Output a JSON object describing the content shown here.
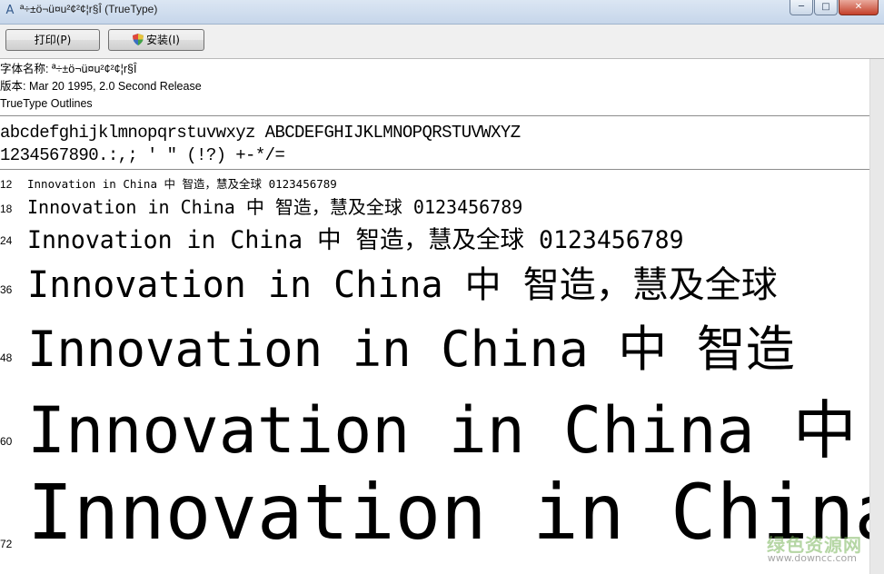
{
  "window": {
    "title": "ª÷±ö¬ü¤u²¢²¢¦r§Î (TrueType)",
    "controls": {
      "minimize": "─",
      "maximize": "□",
      "close": "✕"
    }
  },
  "toolbar": {
    "print_label": "打印(P)",
    "install_label": "安装(I)"
  },
  "font_info": {
    "name_line": "字体名称: ª÷±ö¬ü¤u²¢²¢¦r§Î",
    "version_line": "版本: Mar 20 1995, 2.0 Second Release",
    "type_line": "TrueType Outlines"
  },
  "charset": {
    "line1": "abcdefghijklmnopqrstuvwxyz ABCDEFGHIJKLMNOPQRSTUVWXYZ",
    "line2": "1234567890.:,; ' \" (!?) +-*/="
  },
  "samples": [
    {
      "size": "12",
      "text": "Innovation in China 中  智造，慧及全球 0123456789"
    },
    {
      "size": "18",
      "text": "Innovation in China 中  智造，慧及全球 0123456789"
    },
    {
      "size": "24",
      "text": "Innovation in China 中  智造，慧及全球 0123456789"
    },
    {
      "size": "36",
      "text": "Innovation in China 中  智造，慧及全球"
    },
    {
      "size": "48",
      "text": "Innovation in China 中  智造"
    },
    {
      "size": "60",
      "text": "Innovation in China 中"
    },
    {
      "size": "72",
      "text": "Innovation in China"
    }
  ],
  "watermark": {
    "brand": "绿色资源网",
    "url": "www.downcc.com"
  }
}
